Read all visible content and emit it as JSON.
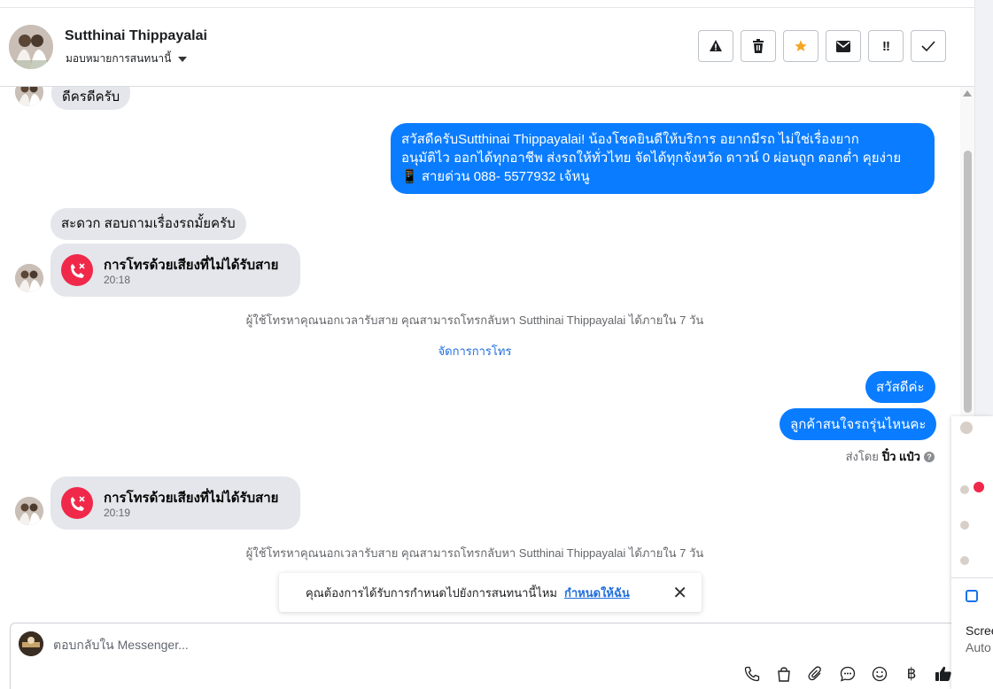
{
  "header": {
    "contact_name": "Sutthinai Thippayalai",
    "assign_label": "มอบหมายการสนทนานี้",
    "actions": [
      {
        "name": "report-button",
        "glyph": "⚠"
      },
      {
        "name": "delete-button",
        "glyph": "🗑"
      },
      {
        "name": "star-button",
        "glyph": "★"
      },
      {
        "name": "mark-unread-button",
        "glyph": "✉"
      },
      {
        "name": "mark-spam-button",
        "glyph": "!!"
      },
      {
        "name": "mark-done-button",
        "glyph": "✓"
      }
    ]
  },
  "thread": {
    "msg_top_partial": "ดีครดีครับ",
    "msg_greeting": {
      "line1": "สวัสดีครับSutthinai Thippayalai! น้องโชคยินดีให้บริการ อยากมีรถ ไม่ใช่เรื่องยาก",
      "line2": "อนุมัติไว ออกได้ทุกอาชีพ ส่งรถให้ทั่วไทย จัดได้ทุกจังหวัด ดาวน์ 0  ผ่อนถูก ดอกต่ำ คุยง่าย",
      "line3": "📱 สายด่วน 088- 5577932 เจ้หนู"
    },
    "msg_inquiry": "สะดวก สอบถามเรื่องรถมั้ยครับ",
    "call1": {
      "title": "การโทรด้วยเสียงที่ไม่ได้รับสาย",
      "time": "20:18"
    },
    "missed_notice_1": "ผู้ใช้โทรหาคุณนอกเวลารับสาย คุณสามารถโทรกลับหา Sutthinai Thippayalai ได้ภายใน 7 วัน",
    "manage_calls": "จัดการการโทร",
    "msg_hello": "สวัสดีค่ะ",
    "msg_model": "ลูกค้าสนใจรถรุ่นไหนคะ",
    "sent_by_prefix": "ส่งโดย",
    "sent_by_name": "ปิ๋ว แป๋ว",
    "call2": {
      "title": "การโทรด้วยเสียงที่ไม่ได้รับสาย",
      "time": "20:19"
    },
    "missed_notice_2": "ผู้ใช้โทรหาคุณนอกเวลารับสาย คุณสามารถโทรกลับหา Sutthinai Thippayalai ได้ภายใน 7 วัน"
  },
  "toast": {
    "text": "คุณต้องการได้รับการกำหนดไปยังการสนทนานี้ไหม",
    "link": "กำหนดให้ฉัน"
  },
  "composer": {
    "placeholder": "ตอบกลับใน Messenger..."
  },
  "side_panel": {
    "label_1": "Scree",
    "label_2": "Auto"
  },
  "colors": {
    "outgoing": "#0a7cff",
    "incoming": "#e4e6eb",
    "missed_call": "#f02849",
    "link": "#216fdb",
    "star": "#f5a623"
  }
}
